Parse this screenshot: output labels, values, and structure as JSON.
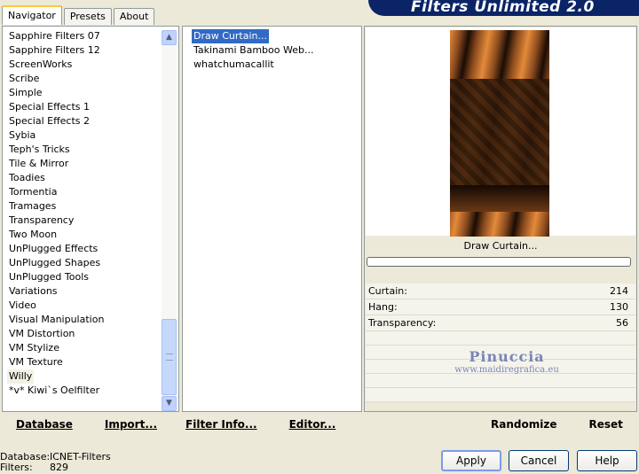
{
  "tabs": [
    "Navigator",
    "Presets",
    "About"
  ],
  "brand": "Filters Unlimited 2.0",
  "categories": [
    "Sapphire Filters 07",
    "Sapphire Filters 12",
    "ScreenWorks",
    "Scribe",
    "Simple",
    "Special Effects 1",
    "Special Effects 2",
    "Sybia",
    "Teph's Tricks",
    "Tile & Mirror",
    "Toadies",
    "Tormentia",
    "Tramages",
    "Transparency",
    "Two Moon",
    "UnPlugged Effects",
    "UnPlugged Shapes",
    "UnPlugged Tools",
    "Variations",
    "Video",
    "Visual Manipulation",
    "VM Distortion",
    "VM Stylize",
    "VM Texture",
    "Willy",
    "*v* Kiwi`s Oelfilter"
  ],
  "filters": [
    "Draw Curtain...",
    "Takinami Bamboo Web...",
    "whatchumacallit"
  ],
  "preview": {
    "caption": "Draw Curtain..."
  },
  "params": [
    {
      "label": "Curtain:",
      "value": "214"
    },
    {
      "label": "Hang:",
      "value": "130"
    },
    {
      "label": "Transparency:",
      "value": "56"
    }
  ],
  "watermark": {
    "line1": "Pinuccia",
    "line2": "www.maidiregrafica.eu"
  },
  "left_buttons": [
    "Database",
    "Import...",
    "Filter Info...",
    "Editor..."
  ],
  "right_buttons": [
    "Randomize",
    "Reset"
  ],
  "status": {
    "db_label": "Database:",
    "db_value": "ICNET-Filters",
    "filters_label": "Filters:",
    "filters_value": "829"
  },
  "dialog_buttons": [
    "Apply",
    "Cancel",
    "Help"
  ],
  "colors": {
    "selection": "#316AC5",
    "brand": "#0A2466"
  }
}
